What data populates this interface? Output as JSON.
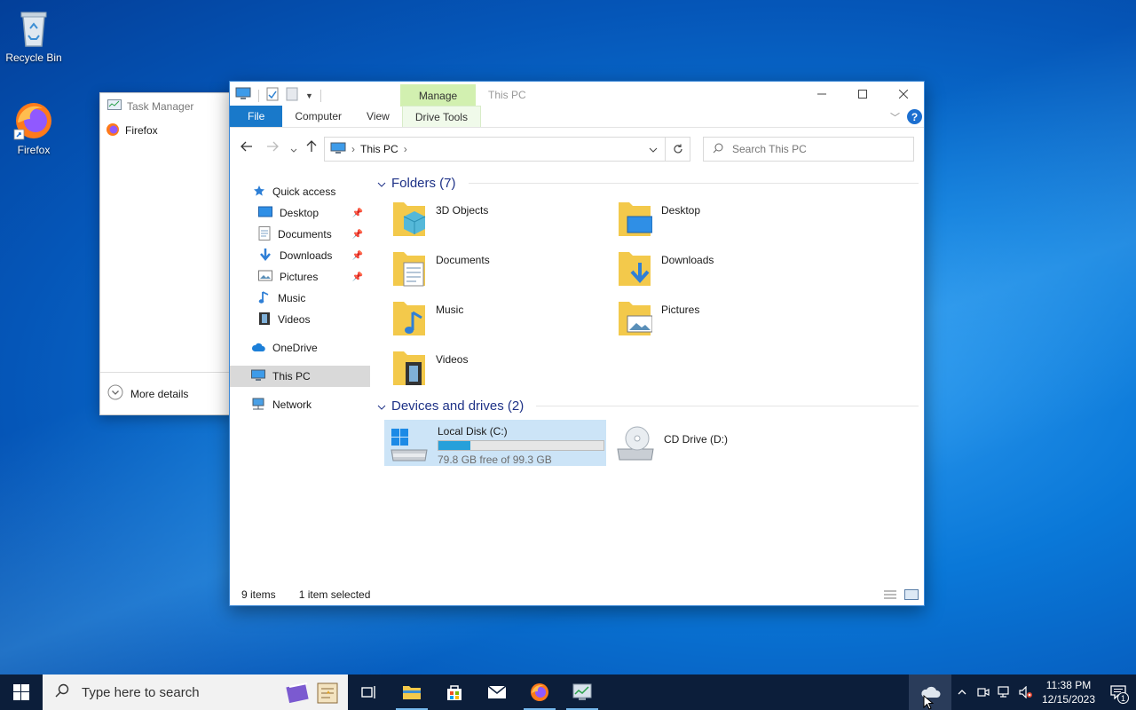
{
  "desktop": {
    "icons": [
      {
        "label": "Recycle Bin"
      },
      {
        "label": "Firefox"
      }
    ]
  },
  "task_manager": {
    "title": "Task Manager",
    "apps": [
      "Firefox"
    ],
    "more_details": "More details"
  },
  "explorer": {
    "context_tab": "Manage",
    "window_title": "This PC",
    "ribbon_tabs": [
      "File",
      "Computer",
      "View",
      "Drive Tools"
    ],
    "address": "This PC",
    "search_placeholder": "Search This PC",
    "nav": {
      "quick_access": "Quick access",
      "quick_items": [
        {
          "label": "Desktop",
          "pinned": true
        },
        {
          "label": "Documents",
          "pinned": true
        },
        {
          "label": "Downloads",
          "pinned": true
        },
        {
          "label": "Pictures",
          "pinned": true
        },
        {
          "label": "Music",
          "pinned": false
        },
        {
          "label": "Videos",
          "pinned": false
        }
      ],
      "onedrive": "OneDrive",
      "this_pc": "This PC",
      "network": "Network"
    },
    "folders_header": "Folders (7)",
    "folders": [
      "3D Objects",
      "Desktop",
      "Documents",
      "Downloads",
      "Music",
      "Pictures",
      "Videos"
    ],
    "devices_header": "Devices and drives (2)",
    "drives": [
      {
        "name": "Local Disk (C:)",
        "free_text": "79.8 GB free of 99.3 GB",
        "used_fraction": 0.196
      },
      {
        "name": "CD Drive (D:)"
      }
    ],
    "status": {
      "items": "9 items",
      "selected": "1 item selected"
    }
  },
  "taskbar": {
    "search_placeholder": "Type here to search",
    "clock_time": "11:38 PM",
    "clock_date": "12/15/2023",
    "notification_count": "1"
  },
  "colors": {
    "accent": "#1979ca",
    "folder": "#f3c94b",
    "drive_fill": "#26a0da",
    "manage_tab": "#d2f0b0"
  }
}
